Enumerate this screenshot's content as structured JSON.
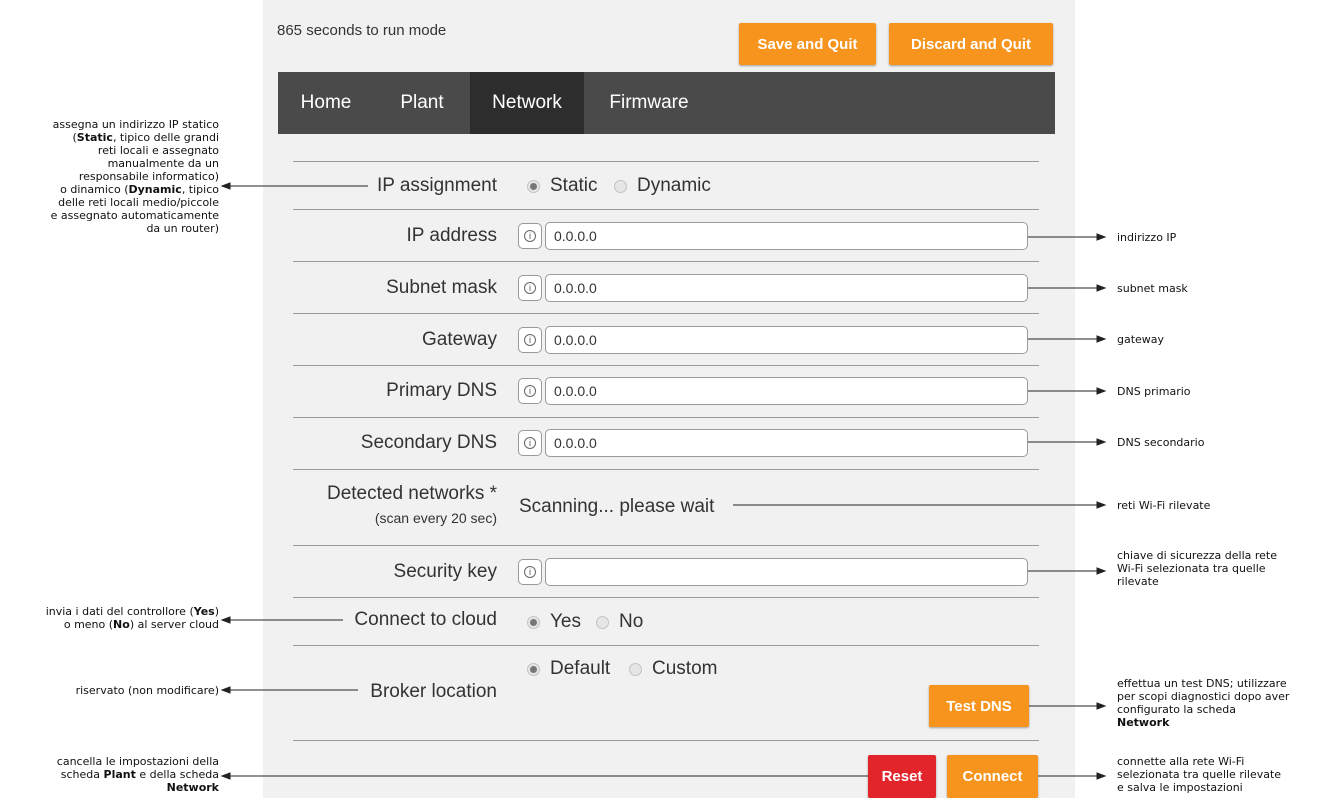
{
  "header": {
    "countdown": "865 seconds to run mode",
    "save_label": "Save and Quit",
    "discard_label": "Discard and Quit"
  },
  "tabs": [
    {
      "label": "Home",
      "active": false
    },
    {
      "label": "Plant",
      "active": false
    },
    {
      "label": "Network",
      "active": true
    },
    {
      "label": "Firmware",
      "active": false
    }
  ],
  "form": {
    "ip_assignment": {
      "label": "IP assignment",
      "options": [
        "Static",
        "Dynamic"
      ],
      "selected": "Static"
    },
    "ip_address": {
      "label": "IP address",
      "value": "0.0.0.0"
    },
    "subnet_mask": {
      "label": "Subnet mask",
      "value": "0.0.0.0"
    },
    "gateway": {
      "label": "Gateway",
      "value": "0.0.0.0"
    },
    "primary_dns": {
      "label": "Primary DNS",
      "value": "0.0.0.0"
    },
    "secondary_dns": {
      "label": "Secondary DNS",
      "value": "0.0.0.0"
    },
    "detected_networks": {
      "label": "Detected networks *",
      "sublabel": "(scan every 20 sec)",
      "status": "Scanning... please wait"
    },
    "security_key": {
      "label": "Security key",
      "value": ""
    },
    "connect_cloud": {
      "label": "Connect to cloud",
      "options": [
        "Yes",
        "No"
      ],
      "selected": "Yes"
    },
    "broker_location": {
      "label": "Broker location",
      "options": [
        "Default",
        "Custom"
      ],
      "selected": "Default"
    },
    "info_glyph": "i",
    "test_dns_label": "Test DNS",
    "reset_label": "Reset",
    "connect_label": "Connect"
  },
  "annotations": {
    "ip_assign": {
      "l1": "assegna un indirizzo IP statico",
      "l2a": "(",
      "l2b": "Static",
      "l2c": ", tipico delle grandi",
      "l3": "reti locali e assegnato",
      "l4": "manualmente da un",
      "l5": "responsabile informatico)",
      "l6a": "o dinamico (",
      "l6b": "Dynamic",
      "l6c": ", tipico",
      "l7": "delle reti locali medio/piccole",
      "l8": "e assegnato automaticamente",
      "l9": "da un router)"
    },
    "ip_address": "indirizzo IP",
    "subnet_mask": "subnet mask",
    "gateway": "gateway",
    "primary_dns": "DNS primario",
    "secondary_dns": "DNS secondario",
    "networks": "reti Wi-Fi rilevate",
    "security": {
      "l1": "chiave di sicurezza della rete",
      "l2": "Wi-Fi selezionata tra quelle",
      "l3": "rilevate"
    },
    "cloud": {
      "l1a": "invia i dati del controllore (",
      "l1b": "Yes",
      "l1c": ")",
      "l2a": "o meno (",
      "l2b": "No",
      "l2c": ") al server cloud"
    },
    "broker": "riservato (non modificare)",
    "test_dns": {
      "l1": "effettua un test DNS; utilizzare",
      "l2": "per scopi diagnostici dopo aver",
      "l3": "configurato la scheda",
      "l4": "Network"
    },
    "reset": {
      "l1": "cancella le impostazioni della",
      "l2a": "scheda ",
      "l2b": "Plant",
      "l2c": " e della scheda",
      "l3": "Network"
    },
    "connect": {
      "l1": "connette alla rete Wi-Fi",
      "l2": "selezionata tra quelle rilevate",
      "l3": "e salva le impostazioni"
    }
  }
}
